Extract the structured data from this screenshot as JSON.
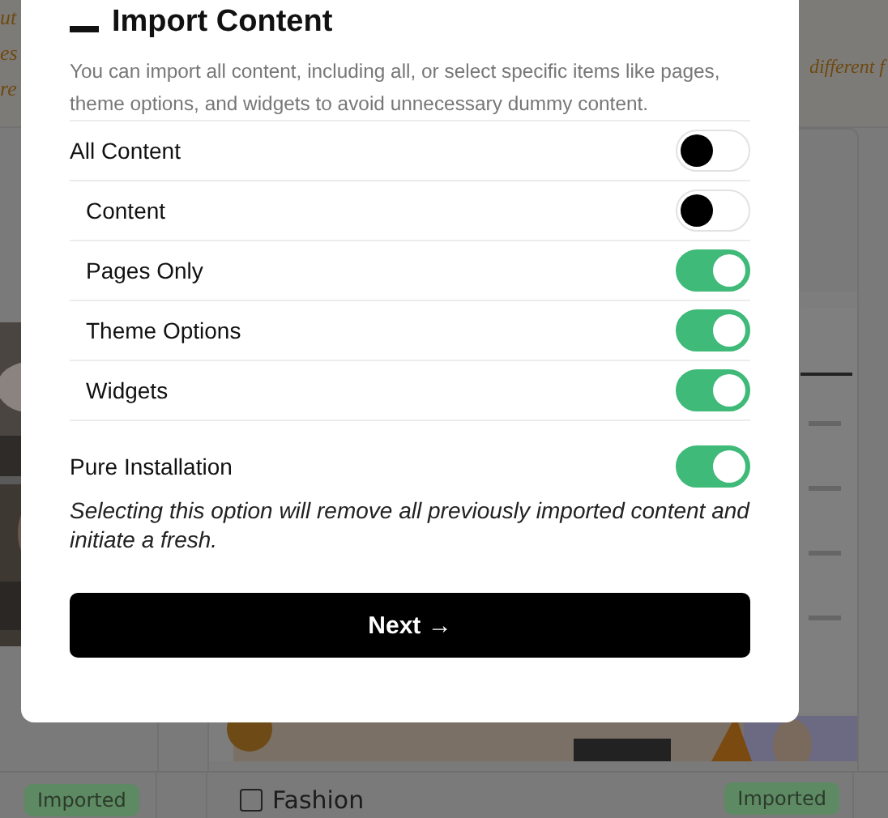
{
  "background": {
    "left_texts": [
      "ut",
      "es",
      "re"
    ],
    "right_text": "different f",
    "left_card": {
      "badge": "Imported"
    },
    "right_card": {
      "title": "Fashion",
      "checked": false,
      "badge": "Imported"
    }
  },
  "modal": {
    "title": "Import Content",
    "description": "You can import all content, including all, or select specific items like pages, theme options, and widgets to avoid unnecessary dummy content.",
    "options": [
      {
        "label": "All Content",
        "on": false,
        "children": [
          {
            "label": "Content",
            "on": false
          },
          {
            "label": "Pages Only",
            "on": true
          },
          {
            "label": "Theme Options",
            "on": true
          },
          {
            "label": "Widgets",
            "on": true
          }
        ]
      }
    ],
    "pure_installation": {
      "label": "Pure Installation",
      "on": true,
      "note": "Selecting this option will remove all previously imported content and initiate a fresh."
    },
    "button": "Next →"
  }
}
